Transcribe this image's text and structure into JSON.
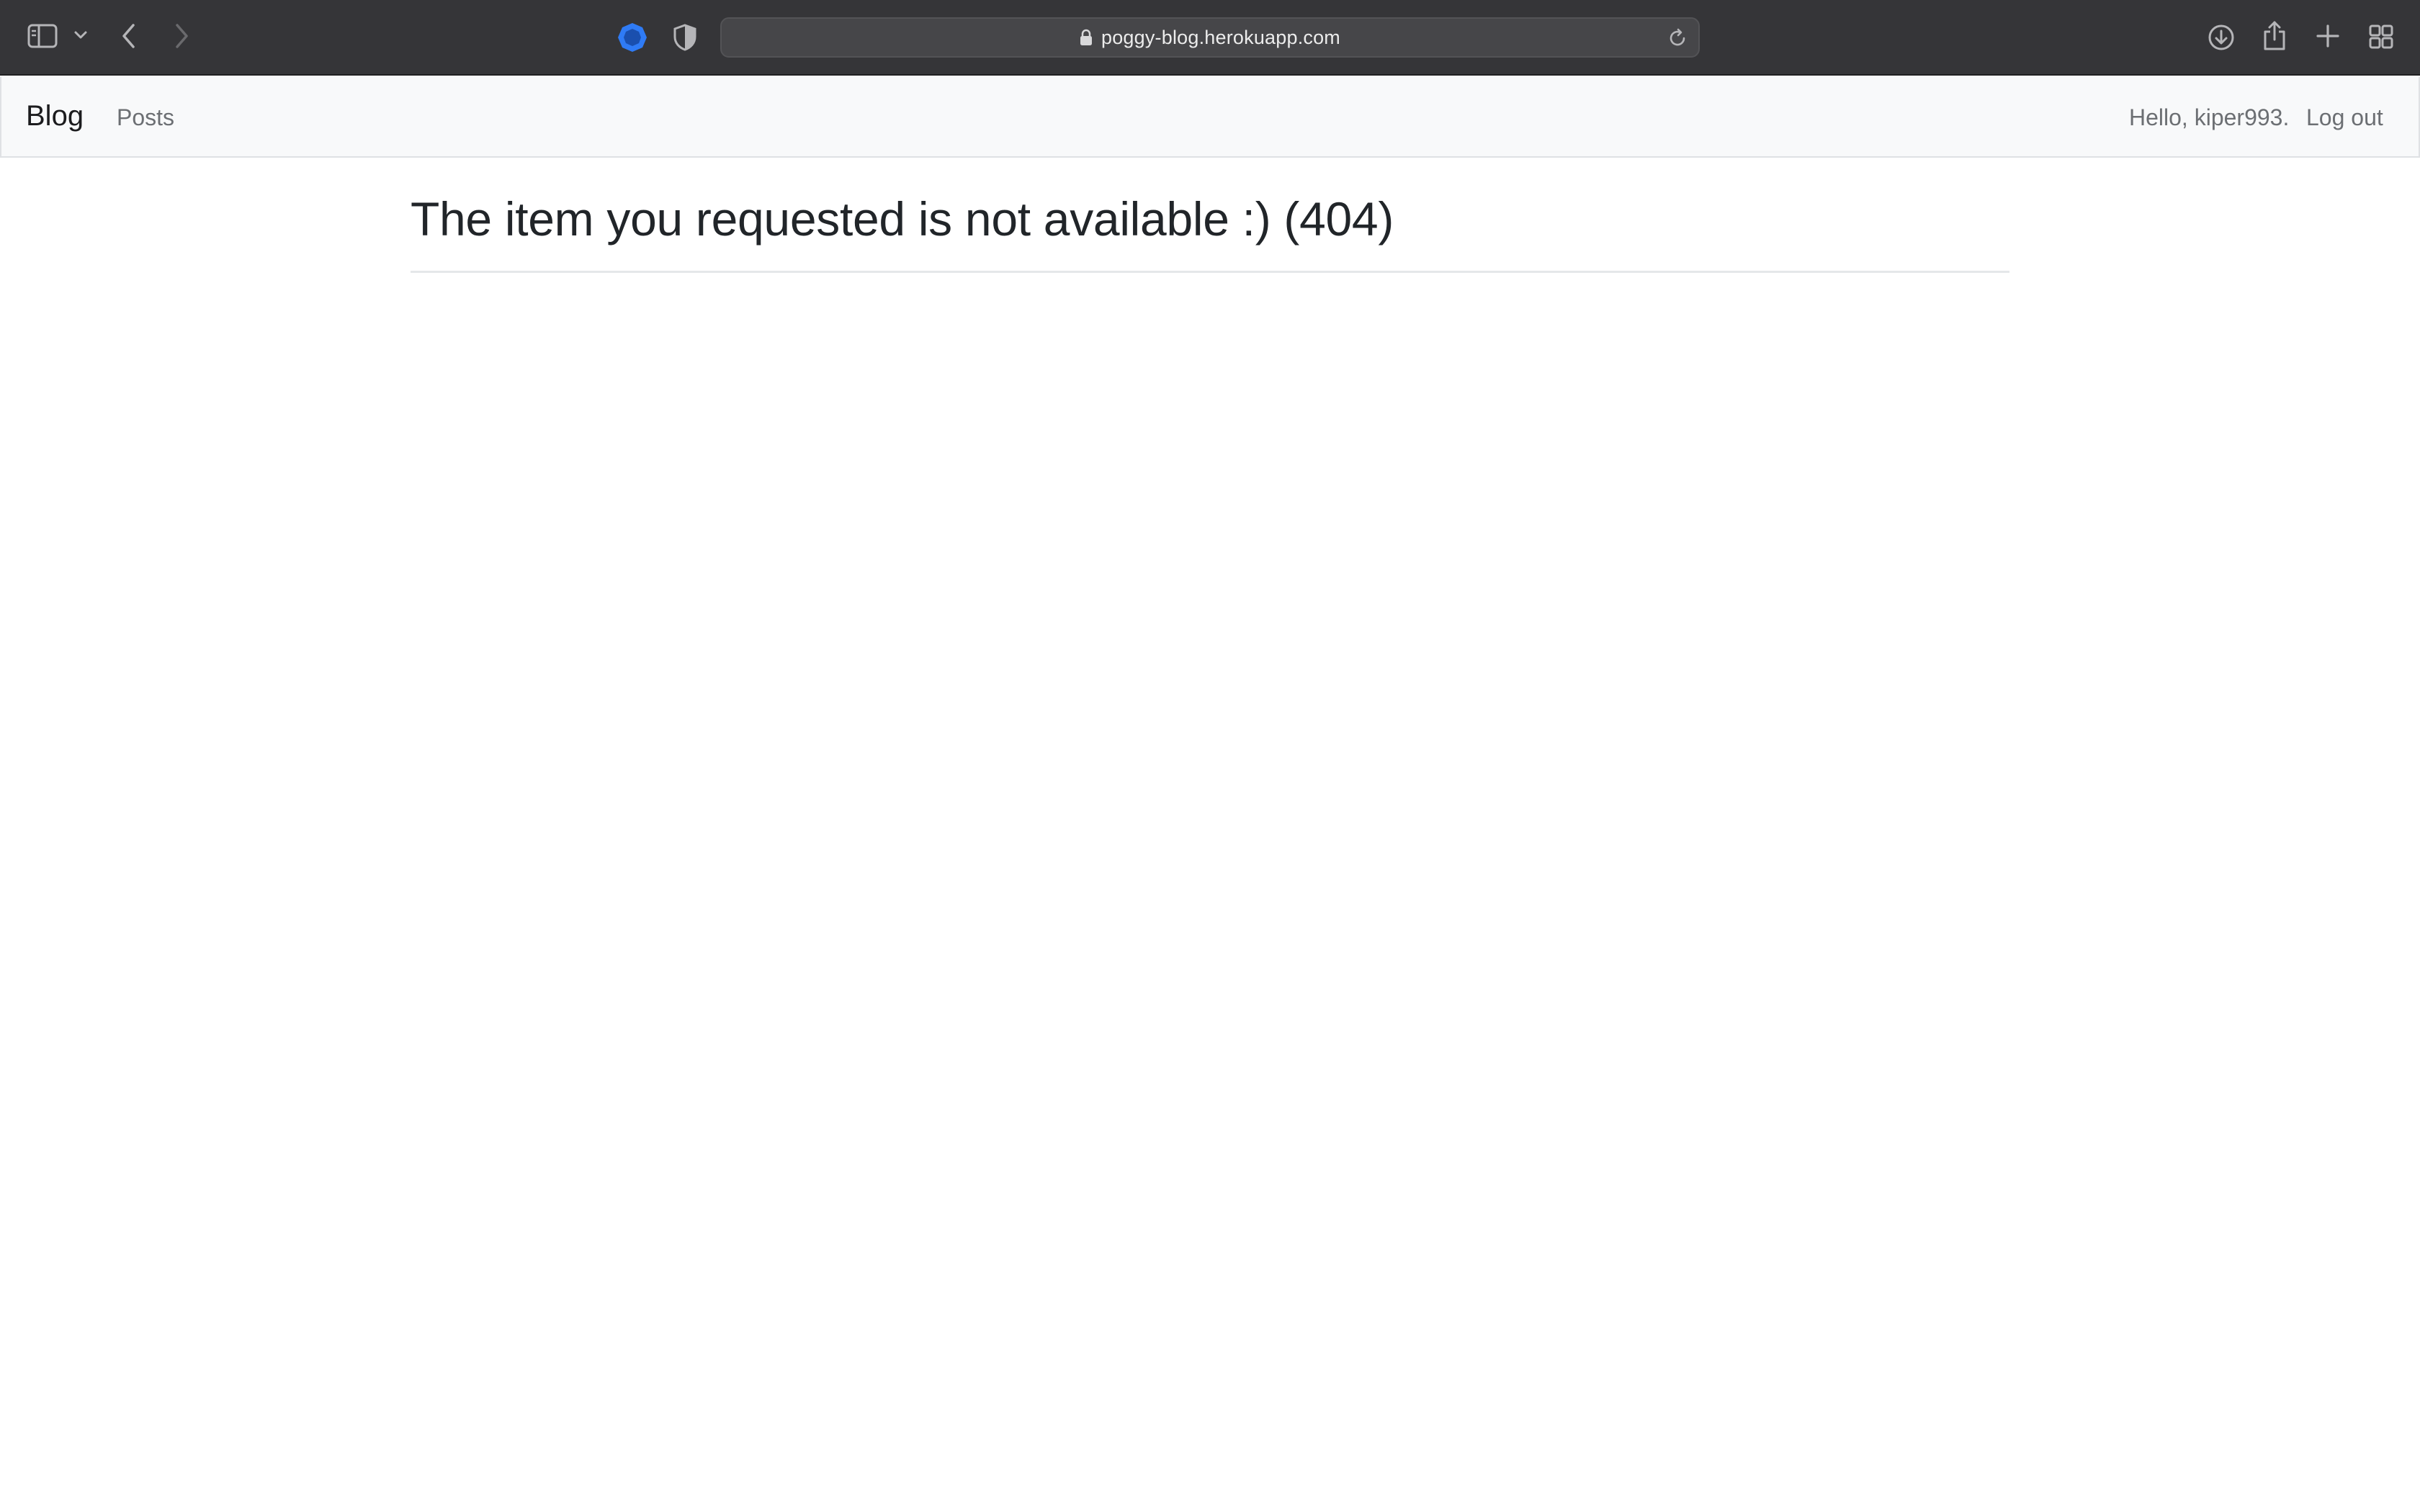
{
  "browser": {
    "url": "poggy-blog.herokuapp.com",
    "icons": {
      "sidebar": "sidebar-icon",
      "sidebar_menu": "chevron-down-icon",
      "back": "chevron-left-icon",
      "forward": "chevron-right-icon",
      "extension": "extension-icon",
      "privacy": "shield-icon",
      "lock": "lock-icon",
      "reload": "reload-icon",
      "downloads": "download-icon",
      "share": "share-icon",
      "new_tab": "plus-icon",
      "tab_overview": "tab-grid-icon"
    },
    "colors": {
      "toolbar": "#353538",
      "extension_accent": "#2f7bf5"
    }
  },
  "navbar": {
    "brand": "Blog",
    "links": [
      "Posts"
    ],
    "greeting": "Hello, kiper993.",
    "logout": "Log out"
  },
  "main": {
    "title": "The item you requested is not available :) (404)"
  }
}
